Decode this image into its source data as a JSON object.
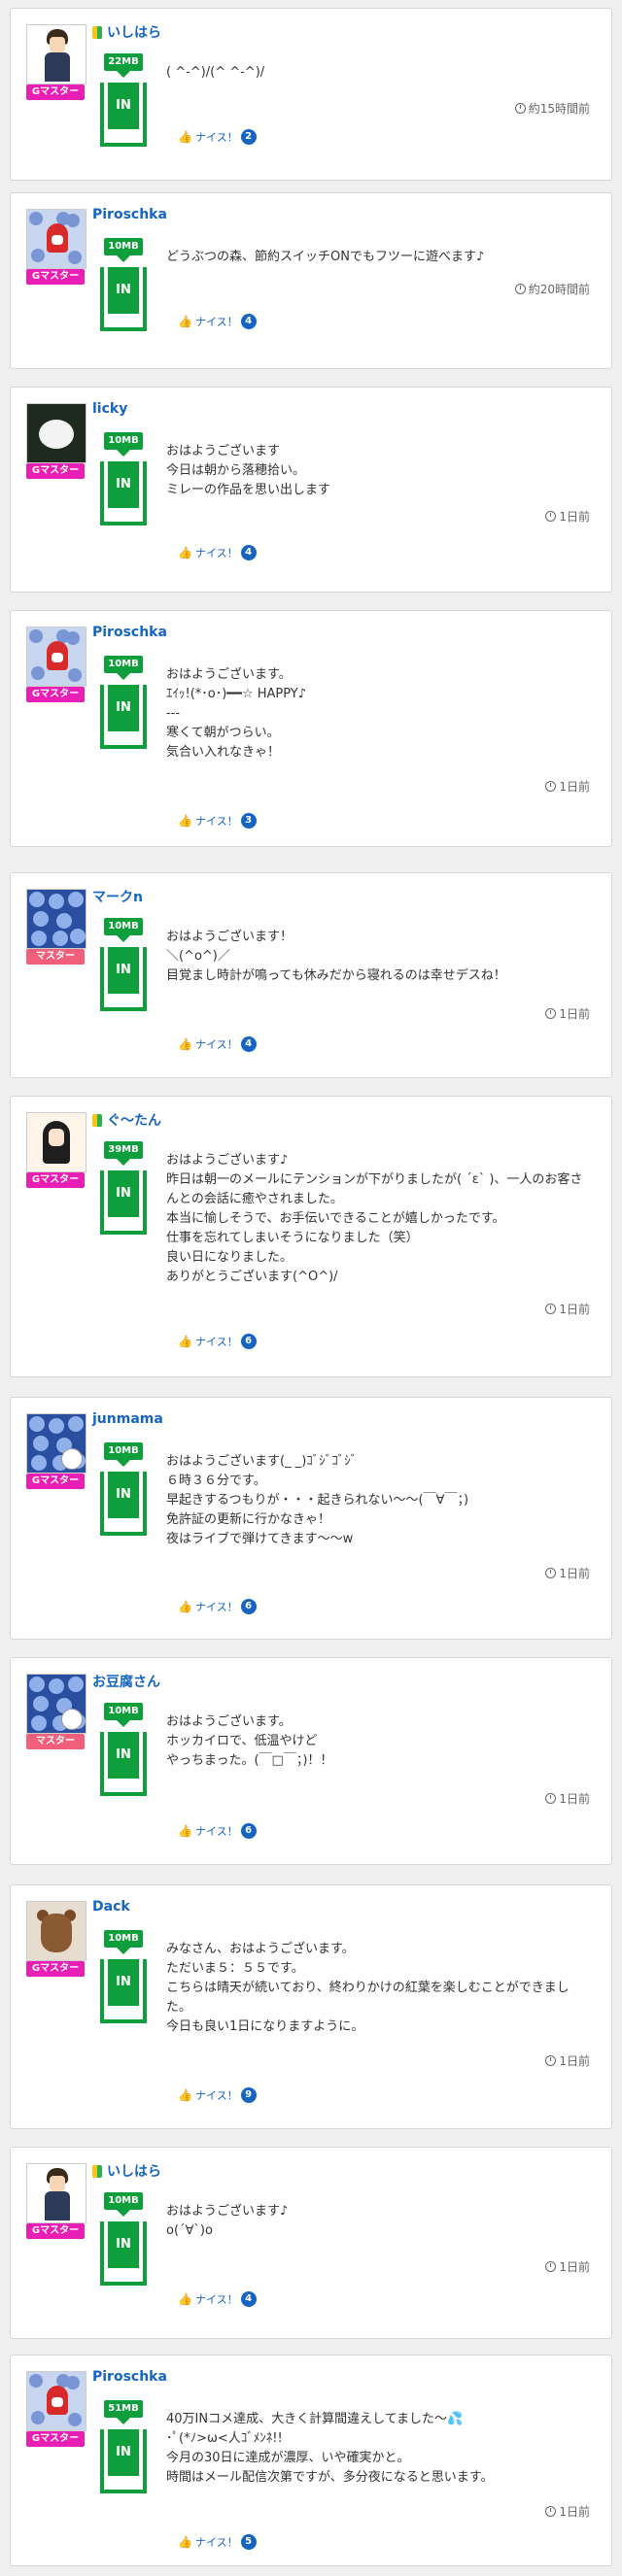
{
  "labels": {
    "nice": "ナイス！",
    "in": "IN"
  },
  "posts": [
    {
      "user": "いしはら",
      "beginner": true,
      "role": "Gマスター",
      "role_color": "#e91eb5",
      "avatar": "boy-avatar",
      "mb": "22MB",
      "message": "( ^-^)/(^ ^-^)/",
      "time": "約15時間前",
      "nice": "2"
    },
    {
      "user": "Piroschka",
      "beginner": false,
      "role": "Gマスター",
      "role_color": "#e91eb5",
      "avatar": "flower-hood-avatar",
      "mb": "10MB",
      "message": "どうぶつの森、節約スイッチONでもフツーに遊べます♪",
      "time": "約20時間前",
      "nice": "4"
    },
    {
      "user": "licky",
      "beginner": false,
      "role": "Gマスター",
      "role_color": "#e91eb5",
      "avatar": "white-dog-avatar",
      "mb": "10MB",
      "message": "おはようございます\n今日は朝から落穂拾い。\nミレーの作品を思い出します",
      "time": "1日前",
      "nice": "4"
    },
    {
      "user": "Piroschka",
      "beginner": false,
      "role": "Gマスター",
      "role_color": "#e91eb5",
      "avatar": "flower-hood-avatar",
      "mb": "10MB",
      "message": "おはようございます。\nｴｲｯ!(*･o･)━━☆ HAPPY♪\n---\n寒くて朝がつらい。\n気合い入れなきゃ！",
      "time": "1日前",
      "nice": "3"
    },
    {
      "user": "マークn",
      "beginner": false,
      "role": "マスター",
      "role_color": "#f0607a",
      "avatar": "blue-flowers-avatar",
      "mb": "10MB",
      "message": "おはようございます！\n＼(^o^)／\n目覚まし時計が鳴っても休みだから寝れるのは幸せデスね！",
      "time": "1日前",
      "nice": "4"
    },
    {
      "user": "ぐ〜たん",
      "beginner": true,
      "role": "Gマスター",
      "role_color": "#e91eb5",
      "avatar": "girl-avatar",
      "mb": "39MB",
      "message": "おはようございます♪\n昨日は朝一のメールにテンションが下がりましたが( ´ε` )、一人のお客さんとの会話に癒やされました。\n本当に愉しそうで、お手伝いできることが嬉しかったです。\n仕事を忘れてしまいそうになりました（笑）\n良い日になりました。\nありがとうございます(^O^)/",
      "time": "1日前",
      "nice": "6"
    },
    {
      "user": "junmama",
      "beginner": false,
      "role": "Gマスター",
      "role_color": "#e91eb5",
      "avatar": "blue-flowers-chick-avatar",
      "mb": "10MB",
      "message": "おはようございます(_ _)ｺﾞｼﾞｺﾞｼﾞ\n６時３６分です。\n早起きするつもりが・・・起きられない〜〜(￣∀￣；)\n免許証の更新に行かなきゃ！\n夜はライブで弾けてきます〜〜w",
      "time": "1日前",
      "nice": "6"
    },
    {
      "user": "お豆腐さん",
      "beginner": false,
      "role": "マスター",
      "role_color": "#f0607a",
      "avatar": "blue-flowers-badge-avatar",
      "mb": "10MB",
      "message": "おはようございます。\nホッカイロで、低温やけど\nやっちまった。(￣□￣；)！！",
      "time": "1日前",
      "nice": "6"
    },
    {
      "user": "Dack",
      "beginner": false,
      "role": "Gマスター",
      "role_color": "#e91eb5",
      "avatar": "teddy-bear-avatar",
      "mb": "10MB",
      "message": "みなさん、おはようございます。\nただいま５：５５です。\nこちらは晴天が続いており、終わりかけの紅葉を楽しむことができました。\n今日も良い1日になりますように。",
      "time": "1日前",
      "nice": "9"
    },
    {
      "user": "いしはら",
      "beginner": true,
      "role": "Gマスター",
      "role_color": "#e91eb5",
      "avatar": "boy-avatar",
      "mb": "10MB",
      "message": "おはようございます♪\no(´∀`)o",
      "time": "1日前",
      "nice": "4"
    },
    {
      "user": "Piroschka",
      "beginner": false,
      "role": "Gマスター",
      "role_color": "#e91eb5",
      "avatar": "flower-hood-avatar",
      "mb": "51MB",
      "message": "40万INコメ達成、大きく計算間違えしてました〜💦\n･ﾟ(*ﾉ>ω<人ｺﾞﾒﾝﾈ!!\n今月の30日に達成が濃厚、いや確実かと。\n時間はメール配信次第ですが、多分夜になると思います。",
      "time": "1日前",
      "nice": "5"
    }
  ]
}
